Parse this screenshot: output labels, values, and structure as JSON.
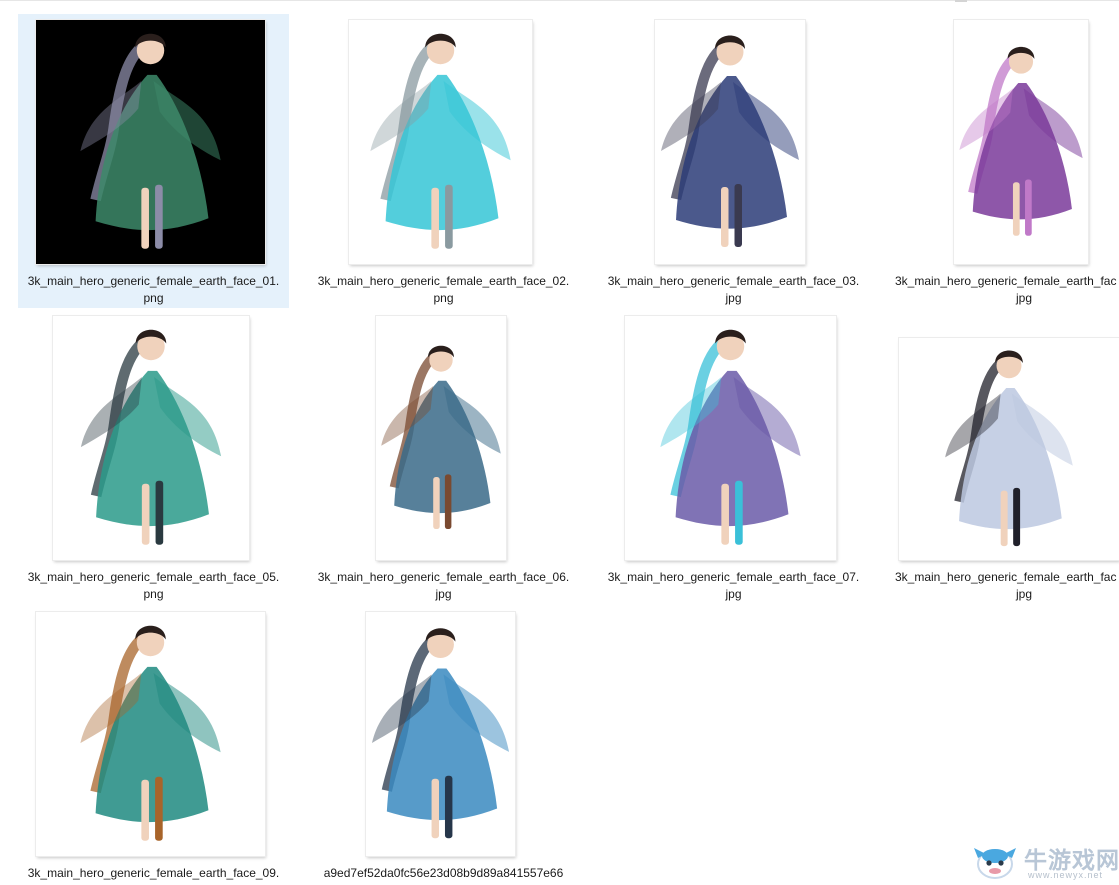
{
  "files": [
    {
      "name_line1": "3k_main_hero_generic_female_earth_face_01.",
      "name_line2": "png",
      "selected": true,
      "bg": "#000000",
      "dress": "#3d8a6a",
      "accent": "#8c8ca8"
    },
    {
      "name_line1": "3k_main_hero_generic_female_earth_face_02.",
      "name_line2": "png",
      "selected": false,
      "bg": "#ffffff",
      "dress": "#35c6d6",
      "accent": "#8a9aa0"
    },
    {
      "name_line1": "3k_main_hero_generic_female_earth_face_03.",
      "name_line2": "jpg",
      "selected": false,
      "bg": "#ffffff",
      "dress": "#2c3c78",
      "accent": "#3a3a50"
    },
    {
      "name_line1": "3k_main_hero_generic_female_earth_fac",
      "name_line2": "jpg",
      "selected": false,
      "bg": "#ffffff",
      "dress": "#7a3a9a",
      "accent": "#c079c8"
    },
    {
      "name_line1": "3k_main_hero_generic_female_earth_face_05.",
      "name_line2": "png",
      "selected": false,
      "bg": "#ffffff",
      "dress": "#2a9a8a",
      "accent": "#2a3a40"
    },
    {
      "name_line1": "3k_main_hero_generic_female_earth_face_06.",
      "name_line2": "jpg",
      "selected": false,
      "bg": "#ffffff",
      "dress": "#3a6a88",
      "accent": "#7a4a30"
    },
    {
      "name_line1": "3k_main_hero_generic_female_earth_face_07.",
      "name_line2": "jpg",
      "selected": false,
      "bg": "#ffffff",
      "dress": "#6a5aa8",
      "accent": "#3ac0d8"
    },
    {
      "name_line1": "3k_main_hero_generic_female_earth_fac",
      "name_line2": "jpg",
      "selected": false,
      "bg": "#ffffff",
      "dress": "#bcc8e0",
      "accent": "#20202a"
    },
    {
      "name_line1": "3k_main_hero_generic_female_earth_face_09.",
      "name_line2": "",
      "selected": false,
      "bg": "#ffffff",
      "dress": "#1f8a80",
      "accent": "#a8642a"
    },
    {
      "name_line1": "a9ed7ef52da0fc56e23d08b9d89a841557e66",
      "name_line2": "",
      "selected": false,
      "bg": "#ffffff",
      "dress": "#3a8ac0",
      "accent": "#26364a"
    }
  ],
  "watermark": {
    "title": "牛游戏网",
    "url": "www.newyx.net"
  }
}
